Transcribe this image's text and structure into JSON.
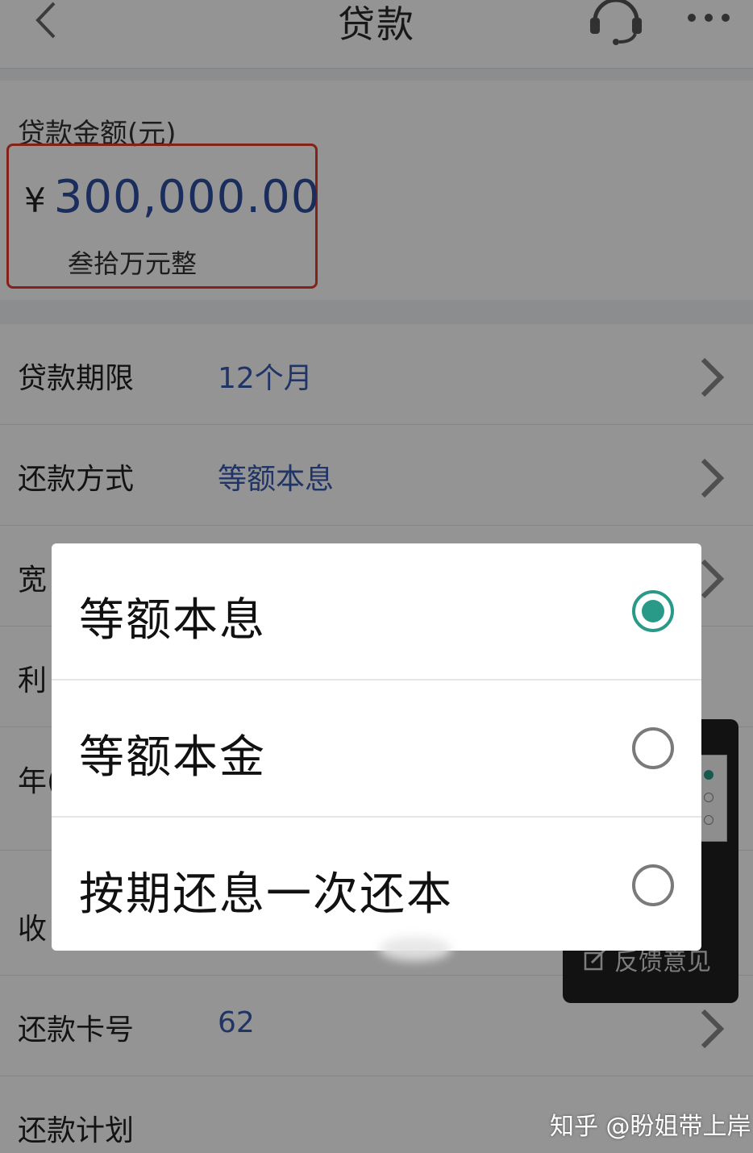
{
  "header": {
    "title": "贷款"
  },
  "amount": {
    "label": "贷款金额(元)",
    "currency": "¥",
    "value": "300,000.00",
    "words": "叁拾万元整"
  },
  "rows": [
    {
      "label": "贷款期限",
      "value": "12个月"
    },
    {
      "label": "还款方式",
      "value": "等额本息"
    },
    {
      "label": "宽",
      "value": ""
    },
    {
      "label": "利",
      "value": ""
    },
    {
      "label": "年(",
      "value": ""
    },
    {
      "label": "收",
      "value": ""
    },
    {
      "label": "还款卡号",
      "value": "62"
    },
    {
      "label": "还款计划",
      "value": ""
    }
  ],
  "dialog": {
    "options": [
      {
        "label": "等额本息",
        "selected": true
      },
      {
        "label": "等额本金",
        "selected": false
      },
      {
        "label": "按期还息一次还本",
        "selected": false
      }
    ]
  },
  "feedback": {
    "label": "反馈意见"
  },
  "watermark": "知乎 @盼姐带上岸",
  "colors": {
    "accent": "#2a9a88",
    "value_blue": "#3a5ab0",
    "highlight_red": "#e53a2f"
  }
}
